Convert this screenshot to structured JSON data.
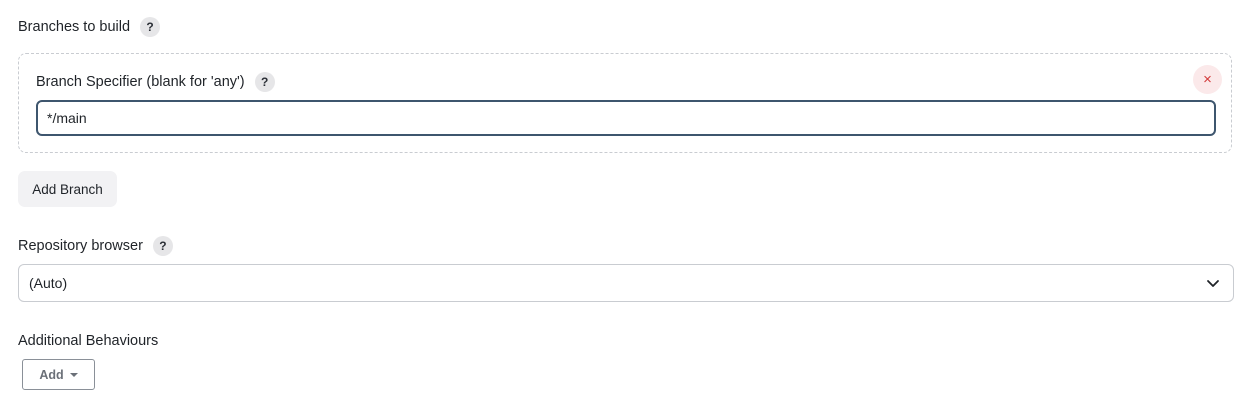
{
  "branches": {
    "label": "Branches to build",
    "help_icon": "?",
    "specifier": {
      "label": "Branch Specifier (blank for 'any')",
      "help_icon": "?",
      "value": "*/main",
      "remove_icon": "×"
    },
    "add_branch_label": "Add Branch"
  },
  "repository_browser": {
    "label": "Repository browser",
    "help_icon": "?",
    "selected": "(Auto)"
  },
  "additional_behaviours": {
    "label": "Additional Behaviours",
    "add_label": "Add"
  },
  "colors": {
    "input_border": "#3e566e",
    "remove_bg": "#fbe9ea",
    "remove_fg": "#d33b3b",
    "help_bg": "#e6e6e8"
  }
}
